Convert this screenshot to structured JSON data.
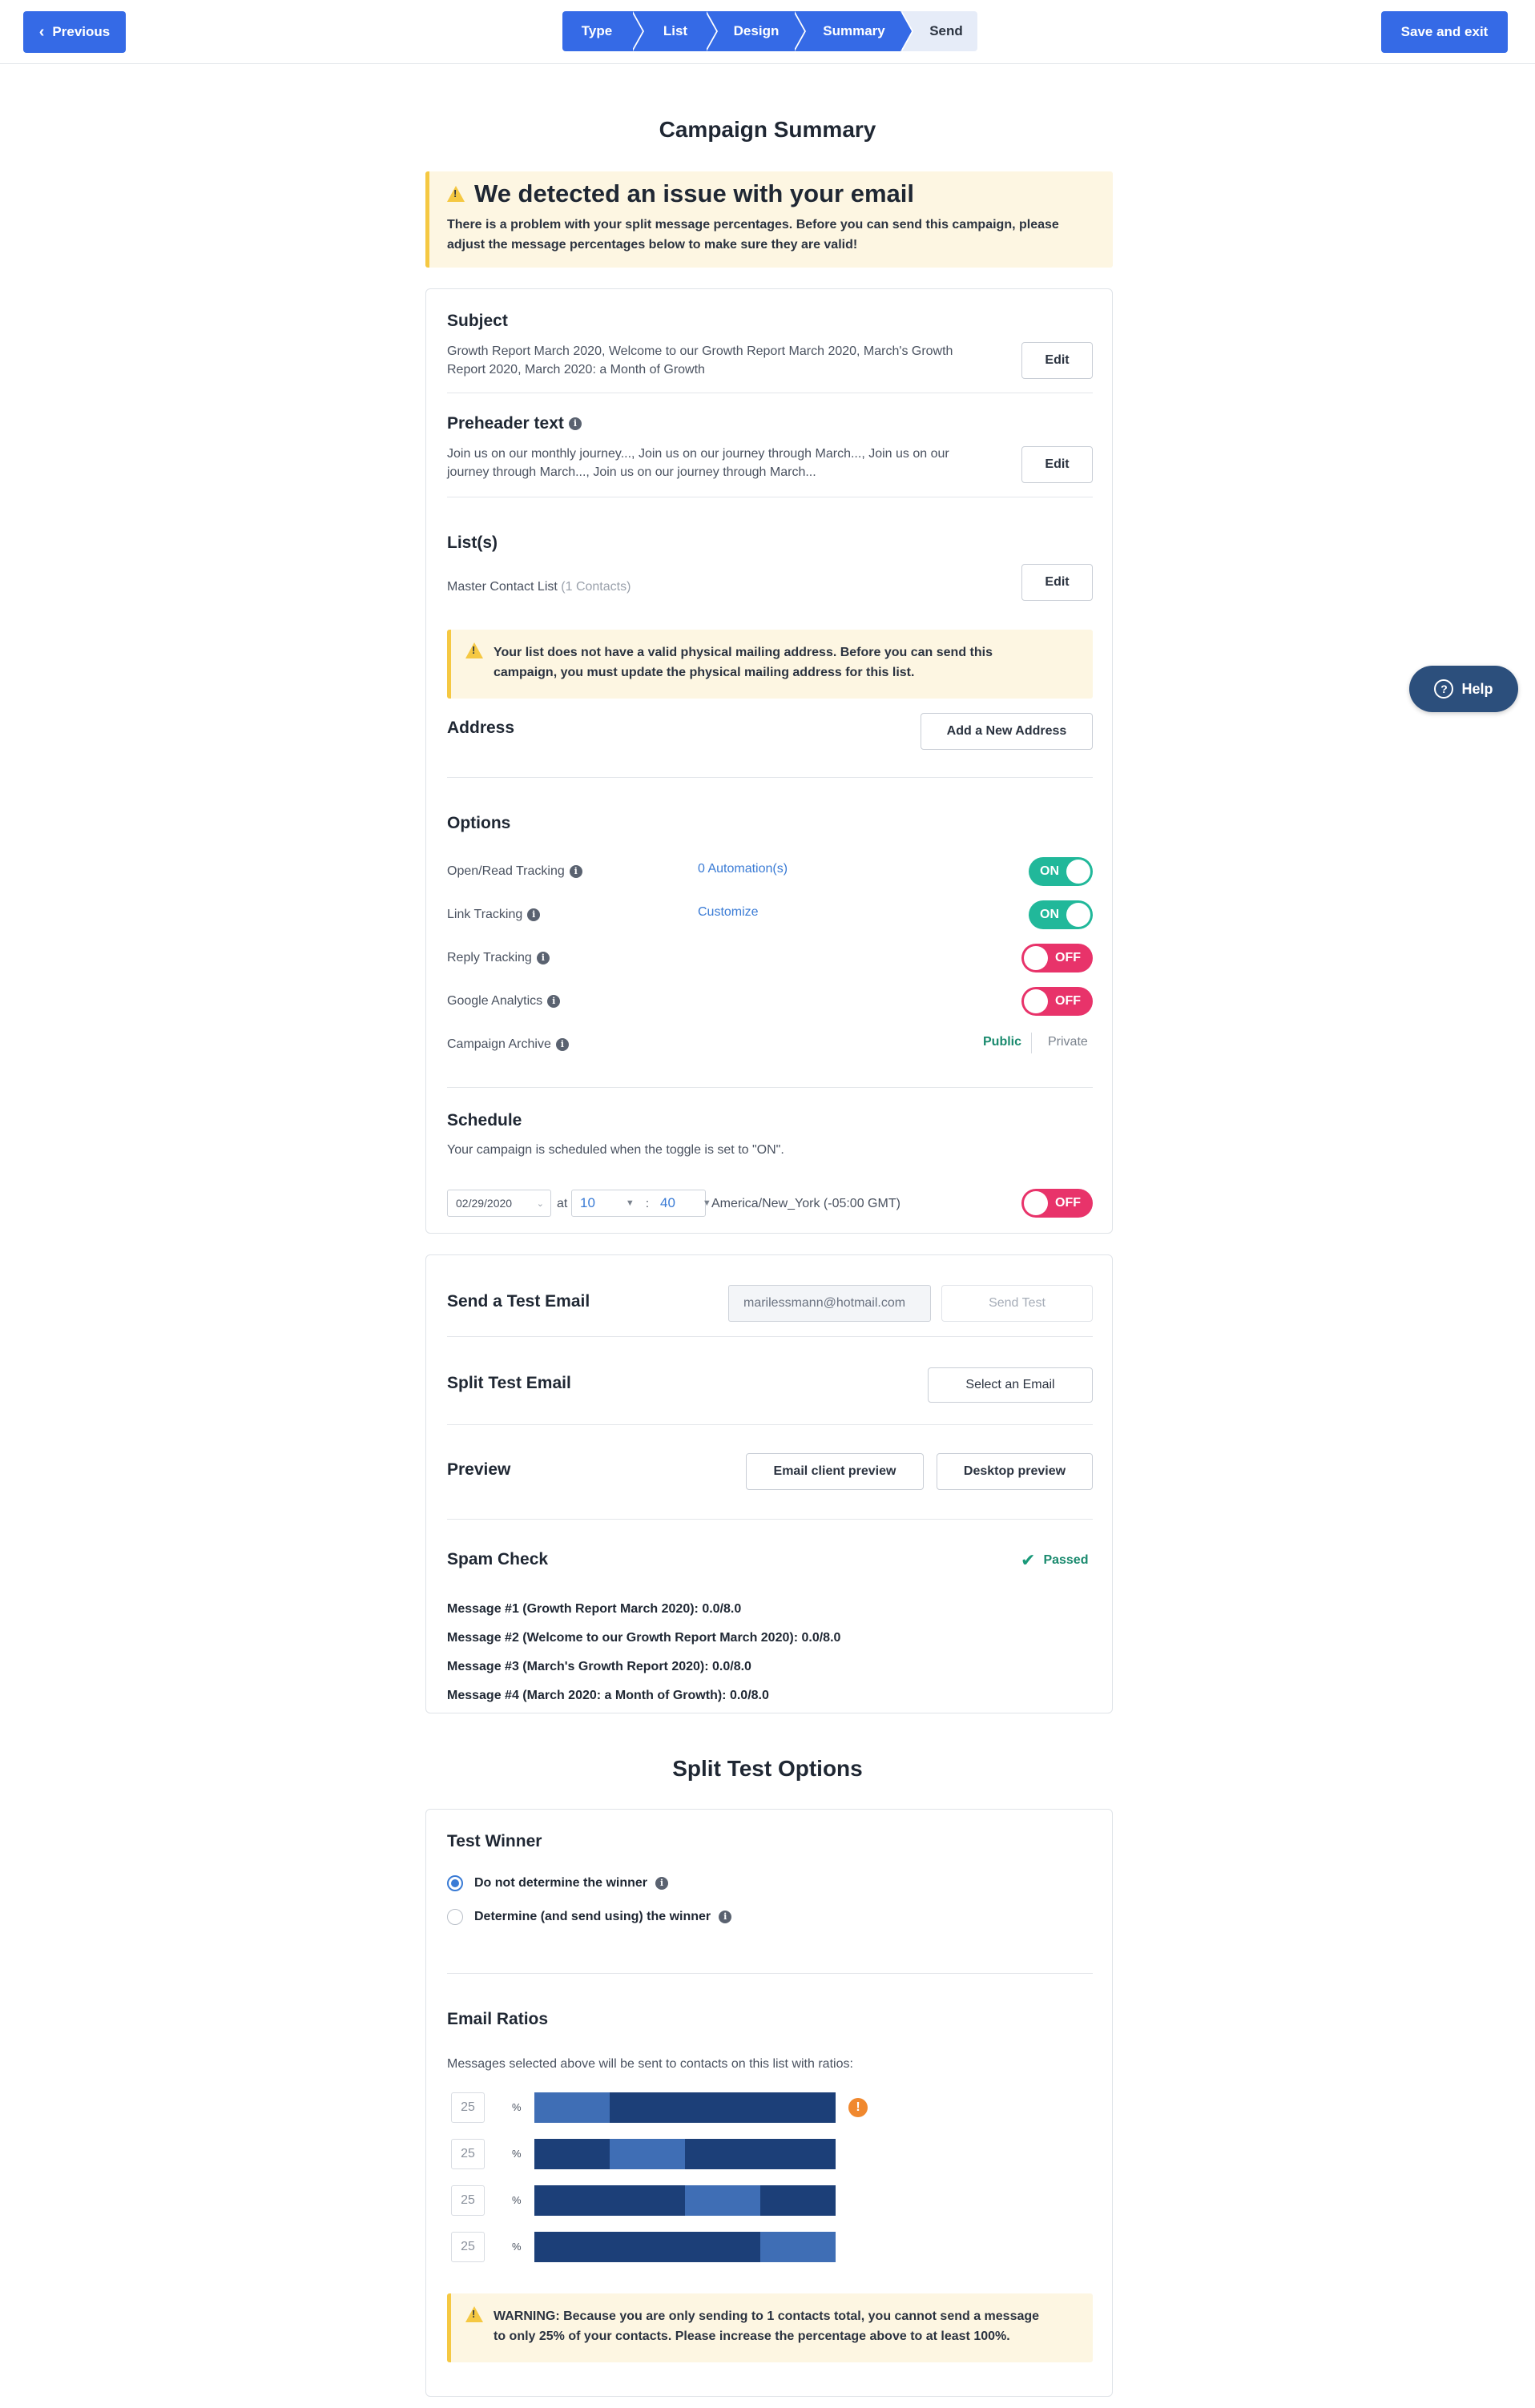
{
  "topbar": {
    "previous_label": "Previous",
    "previous_chevron": "‹",
    "save_exit_label": "Save and exit",
    "steps": [
      "Type",
      "List",
      "Design",
      "Summary",
      "Send"
    ]
  },
  "page_title": "Campaign Summary",
  "issue_alert": {
    "title": "We detected an issue with your email",
    "body_line1": "There is a problem with your split message percentages. Before you can send this campaign, please",
    "body_line2": "adjust the message percentages below to make sure they are valid!"
  },
  "subject": {
    "label": "Subject",
    "line1": "Growth Report March 2020, Welcome to our Growth Report March 2020, March's Growth",
    "line2": "Report 2020, March 2020: a Month of Growth",
    "edit_label": "Edit"
  },
  "preheader": {
    "label": "Preheader text",
    "line1": "Join us on our monthly journey..., Join us on our journey through March..., Join us on our",
    "line2": "journey through March..., Join us on our journey through March...",
    "edit_label": "Edit"
  },
  "lists": {
    "label": "List(s)",
    "list_name": "Master Contact List",
    "contacts": "(1 Contacts)",
    "edit_label": "Edit",
    "warning_line1": "Your list does not have a valid physical mailing address. Before you can send this",
    "warning_line2": "campaign, you must update the physical mailing address for this list."
  },
  "address": {
    "label": "Address",
    "add_label": "Add a New Address"
  },
  "options": {
    "label": "Options",
    "rows": [
      {
        "name": "Open/Read Tracking",
        "link": "0 Automation(s)",
        "state": "ON"
      },
      {
        "name": "Link Tracking",
        "link": "Customize",
        "state": "ON"
      },
      {
        "name": "Reply Tracking",
        "link": "",
        "state": "OFF"
      },
      {
        "name": "Google Analytics",
        "link": "",
        "state": "OFF"
      }
    ],
    "archive": {
      "name": "Campaign Archive",
      "public": "Public",
      "private": "Private"
    }
  },
  "schedule": {
    "label": "Schedule",
    "description": "Your campaign is scheduled when the toggle is set to \"ON\".",
    "date": "02/29/2020",
    "at": "at",
    "hour": "10",
    "colon": ":",
    "minute": "40",
    "timezone": "America/New_York (-05:00 GMT)",
    "state": "OFF"
  },
  "test_email": {
    "label": "Send a Test Email",
    "email_value": "marilessmann@hotmail.com",
    "send_label": "Send Test"
  },
  "split_test_email": {
    "label": "Split Test Email",
    "select_label": "Select an Email"
  },
  "preview": {
    "label": "Preview",
    "client_label": "Email client preview",
    "desktop_label": "Desktop preview"
  },
  "spam_check": {
    "label": "Spam Check",
    "status": "Passed",
    "messages": [
      "Message #1 (Growth Report March 2020): 0.0/8.0",
      "Message #2 (Welcome to our Growth Report March 2020): 0.0/8.0",
      "Message #3 (March's Growth Report 2020): 0.0/8.0",
      "Message #4 (March 2020: a Month of Growth): 0.0/8.0"
    ]
  },
  "split_options_title": "Split Test Options",
  "test_winner": {
    "label": "Test Winner",
    "option1": "Do not determine the winner",
    "option2": "Determine (and send using) the winner",
    "selected": 1
  },
  "email_ratios": {
    "label": "Email Ratios",
    "description": "Messages selected above will be sent to contacts on this list with ratios:",
    "pct_symbol": "%",
    "ratios": [
      "25",
      "25",
      "25",
      "25"
    ],
    "warning_line1": "WARNING: Because you are only sending to 1 contacts total, you cannot send a message",
    "warning_line2": "to only 25% of your contacts. Please increase the percentage above to at least 100%."
  },
  "help_label": "Help",
  "help_icon": "?",
  "info_icon": "i",
  "colors": {
    "primary": "#356ae6",
    "on": "#21b89a",
    "off": "#e8336a",
    "warning_bg": "#fdf6e2",
    "warning_border": "#f5c842",
    "bar_dark": "#1c3f78",
    "bar_light": "#3f6eb5",
    "help_bg": "#2c4f7c"
  }
}
